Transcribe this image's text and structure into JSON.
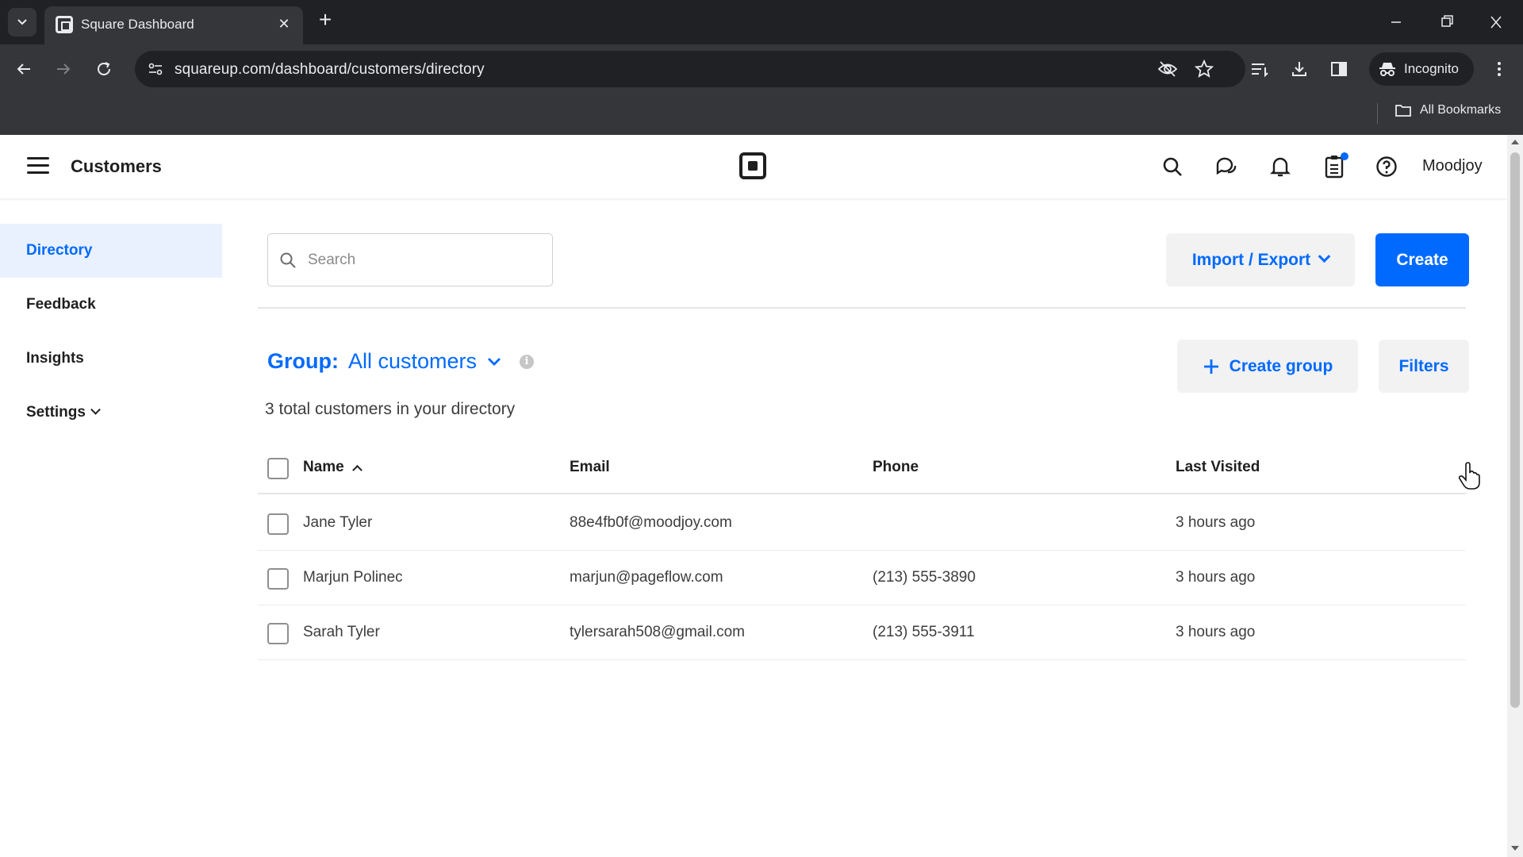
{
  "browser": {
    "tab_title": "Square Dashboard",
    "url": "squareup.com/dashboard/customers/directory",
    "profile_label": "Incognito",
    "bookmarks_label": "All Bookmarks"
  },
  "header": {
    "app_title": "Customers",
    "account_name": "Moodjoy",
    "icons": [
      "menu-icon",
      "square-logo",
      "search-icon",
      "messages-icon",
      "bell-icon",
      "clipboard-icon",
      "help-icon"
    ]
  },
  "sidebar": {
    "items": [
      {
        "label": "Directory",
        "active": true
      },
      {
        "label": "Feedback",
        "active": false
      },
      {
        "label": "Insights",
        "active": false
      },
      {
        "label": "Settings",
        "active": false
      }
    ]
  },
  "search": {
    "placeholder": "Search",
    "value": ""
  },
  "actions": {
    "import_export_label": "Import / Export",
    "create_label": "Create",
    "create_group_label": "Create group",
    "filters_label": "Filters"
  },
  "group": {
    "label": "Group:",
    "value": "All customers"
  },
  "summary_text": "3 total customers in your directory",
  "table": {
    "columns": [
      "Name",
      "Email",
      "Phone",
      "Last Visited"
    ],
    "rows": [
      {
        "name": "Jane Tyler",
        "email": "88e4fb0f@moodjoy.com",
        "phone": "",
        "last_visited": "3 hours ago"
      },
      {
        "name": "Marjun Polinec",
        "email": "marjun@pageflow.com",
        "phone": "(213) 555-3890",
        "last_visited": "3 hours ago"
      },
      {
        "name": "Sarah Tyler",
        "email": "tylersarah508@gmail.com",
        "phone": "(213) 555-3911",
        "last_visited": "3 hours ago"
      }
    ]
  },
  "colors": {
    "brand_blue": "#006aff",
    "active_nav_bg": "#e9f1fe",
    "chrome_dark": "#202124",
    "chrome_toolbar": "#35363a"
  }
}
